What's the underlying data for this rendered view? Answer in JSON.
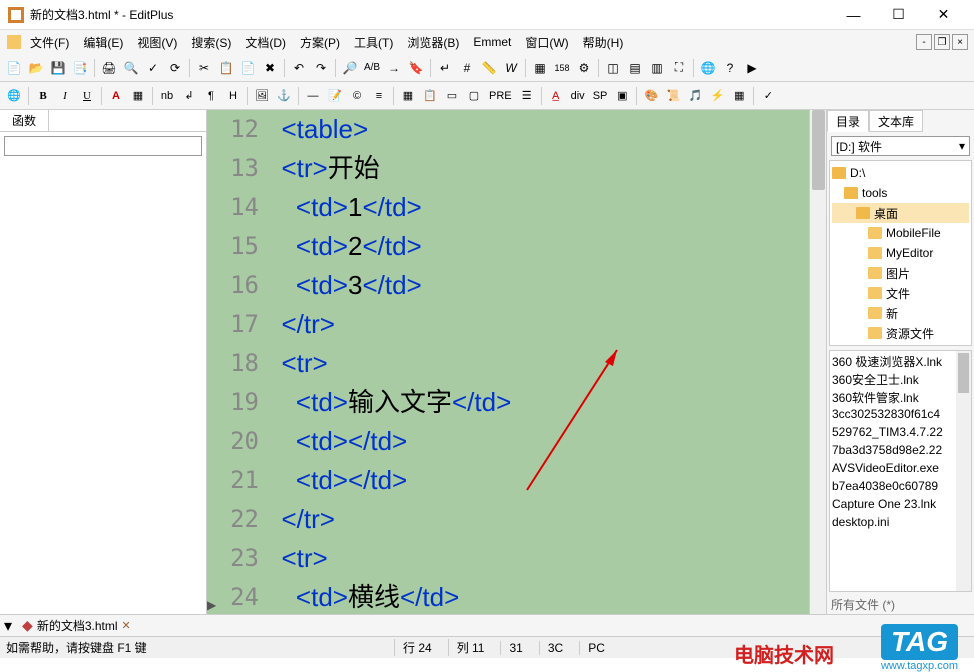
{
  "window": {
    "title": "新的文档3.html * - EditPlus"
  },
  "menu": {
    "file": "文件(F)",
    "edit": "编辑(E)",
    "view": "视图(V)",
    "search": "搜索(S)",
    "document": "文档(D)",
    "project": "方案(P)",
    "tools": "工具(T)",
    "browser": "浏览器(B)",
    "emmet": "Emmet",
    "window": "窗口(W)",
    "help": "帮助(H)"
  },
  "leftPanel": {
    "tab": "函数"
  },
  "editor": {
    "lines": [
      {
        "n": "12",
        "indent": 1,
        "parts": [
          {
            "t": "tag",
            "v": "<table>"
          }
        ]
      },
      {
        "n": "13",
        "indent": 1,
        "parts": [
          {
            "t": "tag",
            "v": "<tr>"
          },
          {
            "t": "text",
            "v": "开始"
          }
        ]
      },
      {
        "n": "14",
        "indent": 2,
        "parts": [
          {
            "t": "tag",
            "v": "<td>"
          },
          {
            "t": "text",
            "v": "1"
          },
          {
            "t": "tag",
            "v": "</td>"
          }
        ]
      },
      {
        "n": "15",
        "indent": 2,
        "parts": [
          {
            "t": "tag",
            "v": "<td>"
          },
          {
            "t": "text",
            "v": "2"
          },
          {
            "t": "tag",
            "v": "</td>"
          }
        ]
      },
      {
        "n": "16",
        "indent": 2,
        "parts": [
          {
            "t": "tag",
            "v": "<td>"
          },
          {
            "t": "text",
            "v": "3"
          },
          {
            "t": "tag",
            "v": "</td>"
          }
        ]
      },
      {
        "n": "17",
        "indent": 1,
        "parts": [
          {
            "t": "tag",
            "v": "</tr>"
          }
        ]
      },
      {
        "n": "18",
        "indent": 1,
        "parts": [
          {
            "t": "tag",
            "v": "<tr>"
          }
        ]
      },
      {
        "n": "19",
        "indent": 2,
        "parts": [
          {
            "t": "tag",
            "v": "<td>"
          },
          {
            "t": "text",
            "v": "输入文字"
          },
          {
            "t": "tag",
            "v": "</td>"
          }
        ]
      },
      {
        "n": "20",
        "indent": 2,
        "parts": [
          {
            "t": "tag",
            "v": "<td>"
          },
          {
            "t": "tag",
            "v": "</td>"
          }
        ]
      },
      {
        "n": "21",
        "indent": 2,
        "parts": [
          {
            "t": "tag",
            "v": "<td>"
          },
          {
            "t": "tag",
            "v": "</td>"
          }
        ]
      },
      {
        "n": "22",
        "indent": 1,
        "parts": [
          {
            "t": "tag",
            "v": "</tr>"
          }
        ]
      },
      {
        "n": "23",
        "indent": 1,
        "parts": [
          {
            "t": "tag",
            "v": "<tr>"
          }
        ]
      },
      {
        "n": "24",
        "indent": 2,
        "parts": [
          {
            "t": "tag",
            "v": "<td>"
          },
          {
            "t": "text",
            "v": "横线"
          },
          {
            "t": "tag",
            "v": "</td>"
          }
        ]
      }
    ]
  },
  "rightPanel": {
    "tab1": "目录",
    "tab2": "文本库",
    "drive": "[D:] 软件",
    "tree": [
      {
        "label": "D:\\",
        "indent": 0,
        "icon": "open"
      },
      {
        "label": "tools",
        "indent": 1,
        "icon": "open"
      },
      {
        "label": "桌面",
        "indent": 2,
        "icon": "open",
        "selected": true
      },
      {
        "label": "MobileFile",
        "indent": 3,
        "icon": "closed"
      },
      {
        "label": "MyEditor",
        "indent": 3,
        "icon": "closed"
      },
      {
        "label": "图片",
        "indent": 3,
        "icon": "closed"
      },
      {
        "label": "文件",
        "indent": 3,
        "icon": "closed"
      },
      {
        "label": "新",
        "indent": 3,
        "icon": "closed"
      },
      {
        "label": "资源文件",
        "indent": 3,
        "icon": "closed"
      }
    ],
    "files": [
      "360 极速浏览器X.lnk",
      "360安全卫士.lnk",
      "360软件管家.lnk",
      "3cc302532830f61c4",
      "529762_TIM3.4.7.22",
      "7ba3d3758d98e2.22",
      "AVSVideoEditor.exe",
      "b7ea4038e0c60789",
      "Capture One 23.lnk",
      "desktop.ini"
    ],
    "cutoff": "所有文件 (*)"
  },
  "docTabs": {
    "tab1": "新的文档3.html"
  },
  "statusbar": {
    "help": "如需帮助，请按键盘 F1 键",
    "line": "行 24",
    "col": "列 11",
    "sel": "31",
    "lines": "3C",
    "mode": "PC"
  },
  "watermarks": {
    "site": "电脑技术网",
    "tag": "TAG",
    "url": "www.tagxp.com"
  }
}
